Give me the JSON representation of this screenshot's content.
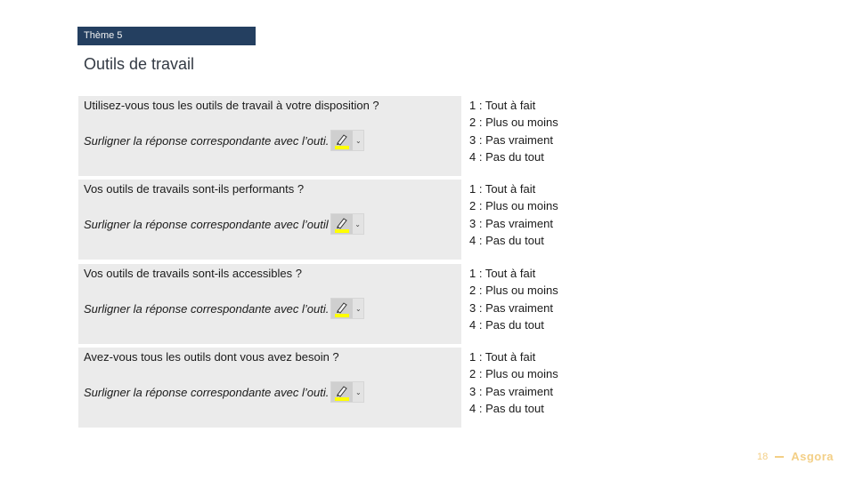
{
  "header": {
    "theme_label": "Thème 5",
    "title": "Outils de travail"
  },
  "questions": [
    {
      "question": "Utilisez-vous tous les outils de travail à votre disposition ?",
      "instruction": "Surligner la réponse correspondante avec l’outi.",
      "options": [
        "1 : Tout à fait",
        "2 : Plus ou moins",
        "3 : Pas vraiment",
        "4 : Pas du tout"
      ]
    },
    {
      "question": "Vos outils de travails sont-ils performants ?",
      "instruction": "Surligner la réponse correspondante avec l’outil",
      "options": [
        "1 : Tout à fait",
        "2 : Plus ou moins",
        "3 : Pas vraiment",
        "4 : Pas du tout"
      ]
    },
    {
      "question": "Vos outils de travails sont-ils accessibles ?",
      "instruction": "Surligner la réponse correspondante avec l’outi.",
      "options": [
        "1 : Tout à fait",
        "2 : Plus ou moins",
        "3 : Pas vraiment",
        "4 : Pas du tout"
      ]
    },
    {
      "question": "Avez-vous tous les outils dont vous avez besoin ?",
      "instruction": "Surligner la réponse correspondante avec l’outi.",
      "options": [
        "1 : Tout à fait",
        "2 : Plus ou moins",
        "3 : Pas vraiment",
        "4 : Pas du tout"
      ]
    }
  ],
  "tool": {
    "icon": "highlighter-icon",
    "dropdown_icon": "chevron-down-icon",
    "highlight_color": "#ffff00",
    "dropdown_glyph": "⌄"
  },
  "footer": {
    "page_number": "18",
    "brand": "Asgora"
  },
  "colors": {
    "theme_bar": "#243f60",
    "row_background": "#ebebeb",
    "footer_accent": "#f3cf86"
  }
}
